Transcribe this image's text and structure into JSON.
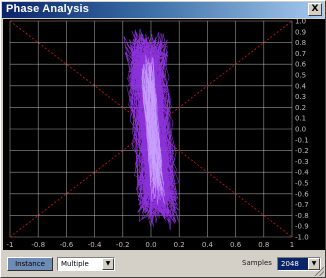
{
  "window": {
    "title": "Phase Analysis",
    "close_label": "X"
  },
  "plot": {
    "y_ticks": [
      "1.0",
      "0.9",
      "0.8",
      "0.7",
      "0.6",
      "0.5",
      "0.4",
      "0.3",
      "0.2",
      "0.1",
      "0.0",
      "-0.1",
      "-0.2",
      "-0.3",
      "-0.4",
      "-0.5",
      "-0.6",
      "-0.7",
      "-0.8",
      "-0.9",
      "-1.0"
    ],
    "x_ticks": [
      "-1",
      "-0.8",
      "-0.6",
      "-0.4",
      "-0.2",
      "0.0",
      "0.2",
      "0.4",
      "0.6",
      "0.8",
      "1"
    ],
    "colors": {
      "background": "#000000",
      "grid": "#c8c8c8",
      "diagonal": "#d01818",
      "trace": "#9a36f0"
    }
  },
  "controls": {
    "button_label": "Instance",
    "mode_value": "Multiple",
    "samples_label": "Samples",
    "samples_value": "2048"
  }
}
